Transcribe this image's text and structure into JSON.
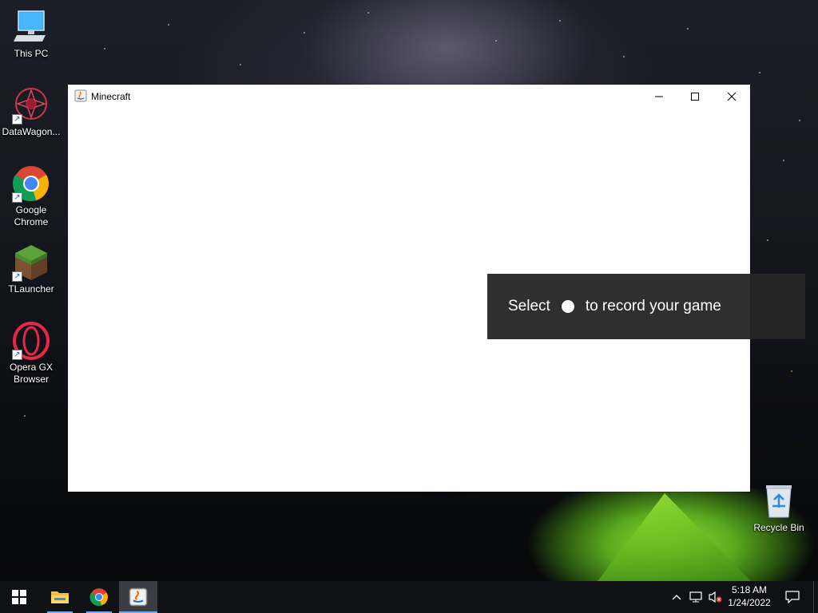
{
  "desktop": {
    "icons": [
      {
        "label": "This PC",
        "icon": "this-pc-icon"
      },
      {
        "label": "DataWagon...",
        "icon": "datawagon-icon"
      },
      {
        "label": "Google Chrome",
        "icon": "chrome-icon"
      },
      {
        "label": "TLauncher",
        "icon": "tlauncher-icon"
      },
      {
        "label": "Opera GX Browser",
        "icon": "opera-gx-icon"
      },
      {
        "label": "Recycle Bin",
        "icon": "recycle-bin-icon"
      }
    ]
  },
  "window": {
    "title": "Minecraft",
    "icon": "java-icon",
    "controls": {
      "minimize": "minimize-icon",
      "maximize": "maximize-icon",
      "close": "close-icon"
    }
  },
  "gamebar": {
    "text_before": "Select",
    "text_after": "to record your game"
  },
  "taskbar": {
    "start": "windows-start-icon",
    "apps": [
      "file-explorer-icon",
      "chrome-icon",
      "java-icon"
    ],
    "tray": {
      "time": "5:18 AM",
      "date": "1/24/2022",
      "icons": [
        "chevron-up-icon",
        "network-icon",
        "volume-muted-icon",
        "notifications-icon"
      ]
    }
  },
  "colors": {
    "taskbar_bg": "#101114",
    "gamebar_bg": "#262626",
    "active_underline": "#76a7e6"
  }
}
